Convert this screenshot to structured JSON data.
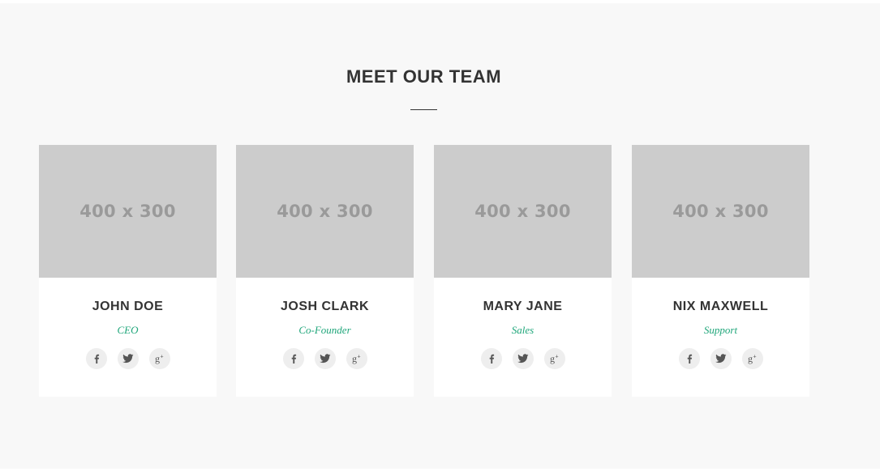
{
  "section": {
    "title": "MEET OUR TEAM"
  },
  "colors": {
    "background": "#f8f8f8",
    "card": "#ffffff",
    "placeholder": "#cccccc",
    "role_accent": "#1fa67a",
    "text_dark": "#333333"
  },
  "team": [
    {
      "name": "JOHN DOE",
      "role": "CEO",
      "photo_label": "400 x 300",
      "socials": [
        "facebook-icon",
        "twitter-icon",
        "google-plus-icon"
      ]
    },
    {
      "name": "JOSH CLARK",
      "role": "Co-Founder",
      "photo_label": "400 x 300",
      "socials": [
        "facebook-icon",
        "twitter-icon",
        "google-plus-icon"
      ]
    },
    {
      "name": "MARY JANE",
      "role": "Sales",
      "photo_label": "400 x 300",
      "socials": [
        "facebook-icon",
        "twitter-icon",
        "google-plus-icon"
      ]
    },
    {
      "name": "NIX MAXWELL",
      "role": "Support",
      "photo_label": "400 x 300",
      "socials": [
        "facebook-icon",
        "twitter-icon",
        "google-plus-icon"
      ]
    }
  ]
}
